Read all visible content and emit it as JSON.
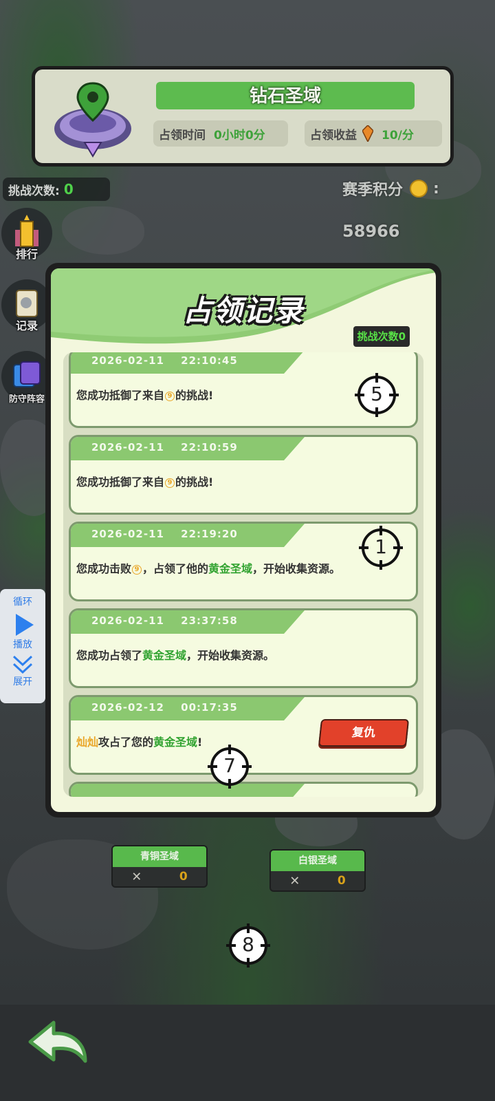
{
  "territory": {
    "name": "钻石圣域",
    "occupy_time_label": "占领时间",
    "occupy_time_value": "0小时0分",
    "occupy_income_label": "占领收益",
    "occupy_income_value": "10/分"
  },
  "hud": {
    "challenge_count_label": "挑战次数:",
    "challenge_count_value": "0",
    "season_label": "赛季积分",
    "season_separator": ":",
    "season_value": "58966"
  },
  "side_menu": [
    {
      "label": "排行",
      "icon": "trophy-icon"
    },
    {
      "label": "记录",
      "icon": "scroll-icon"
    },
    {
      "label": "防守阵容",
      "icon": "cards-icon"
    }
  ],
  "play_widget": {
    "loop_label": "循环",
    "play_label": "播放",
    "expand_label": "展开"
  },
  "dialog": {
    "title": "占领记录",
    "challenge_count": "挑战次数0",
    "records": [
      {
        "timestamp": "2026-02-11 22:10:45",
        "parts": [
          {
            "t": "您成功抵御了来自"
          },
          {
            "coin": "9"
          },
          {
            "t": "的挑战!"
          }
        ]
      },
      {
        "timestamp": "2026-02-11 22:10:59",
        "parts": [
          {
            "t": "您成功抵御了来自"
          },
          {
            "coin": "9"
          },
          {
            "t": "的挑战!"
          }
        ]
      },
      {
        "timestamp": "2026-02-11 22:19:20",
        "parts": [
          {
            "t": "您成功击败"
          },
          {
            "coin": "9"
          },
          {
            "t": "，占领了他的"
          },
          {
            "green": "黄金圣域"
          },
          {
            "t": "，开始收集资源。"
          }
        ]
      },
      {
        "timestamp": "2026-02-11 23:37:58",
        "parts": [
          {
            "t": "您成功占领了"
          },
          {
            "green": "黄金圣域"
          },
          {
            "t": "，开始收集资源。"
          }
        ]
      },
      {
        "timestamp": "2026-02-12 00:17:35",
        "parts": [
          {
            "gold": "灿灿"
          },
          {
            "t": "攻占了您的"
          },
          {
            "green": "黄金圣域"
          },
          {
            "t": "!"
          }
        ],
        "button": "复仇"
      }
    ]
  },
  "map_slots": [
    {
      "name": "青铜圣域",
      "count": "0"
    },
    {
      "name": "白银圣域",
      "count": "0"
    }
  ],
  "markers": [
    "5",
    "1",
    "7",
    "8"
  ],
  "colors": {
    "accent_green": "#5dbb4f",
    "dialog_bg": "#f3f7dd",
    "revenge_red": "#e2412a",
    "gold_text": "#eaa72a"
  }
}
